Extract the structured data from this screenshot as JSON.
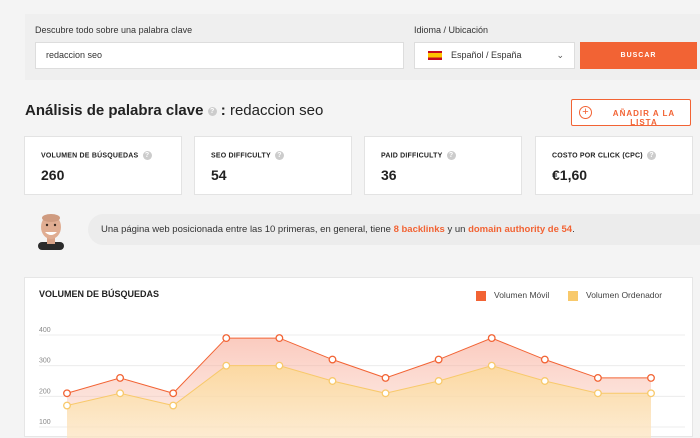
{
  "search": {
    "keyword_label": "Descubre todo sobre una palabra clave",
    "keyword_value": "redaccion seo",
    "location_label": "Idioma / Ubicación",
    "location_value": "Español / España",
    "button_label": "BUSCAR"
  },
  "header": {
    "title": "Análisis de palabra clave",
    "separator": ":",
    "keyword": "redaccion seo",
    "add_button": "AÑADIR A LA LISTA"
  },
  "metrics": [
    {
      "label": "VOLUMEN DE BÚSQUEDAS",
      "value": "260"
    },
    {
      "label": "SEO DIFFICULTY",
      "value": "54"
    },
    {
      "label": "PAID DIFFICULTY",
      "value": "36"
    },
    {
      "label": "COSTO POR CLICK (CPC)",
      "value": "€1,60"
    }
  ],
  "message": {
    "prefix": "Una página web posicionada entre las 10 primeras, en general, tiene",
    "backlinks": "8 backlinks",
    "middle": "y un",
    "authority": "domain authority de 54",
    "suffix": "."
  },
  "colors": {
    "accent": "#f26334",
    "desktop": "#f8c96b"
  },
  "chart_data": {
    "type": "area",
    "title": "VOLUMEN DE BÚSQUEDAS",
    "yticks": [
      100,
      200,
      300,
      400
    ],
    "ylim": [
      100,
      400
    ],
    "legend_position": "top-right",
    "series": [
      {
        "name": "Volumen Móvil",
        "color": "#f26334",
        "values": [
          210,
          260,
          210,
          390,
          390,
          320,
          260,
          320,
          390,
          320,
          260,
          260
        ]
      },
      {
        "name": "Volumen Ordenador",
        "color": "#f8c96b",
        "values": [
          170,
          210,
          170,
          300,
          300,
          250,
          210,
          250,
          300,
          250,
          210,
          210
        ]
      }
    ]
  }
}
